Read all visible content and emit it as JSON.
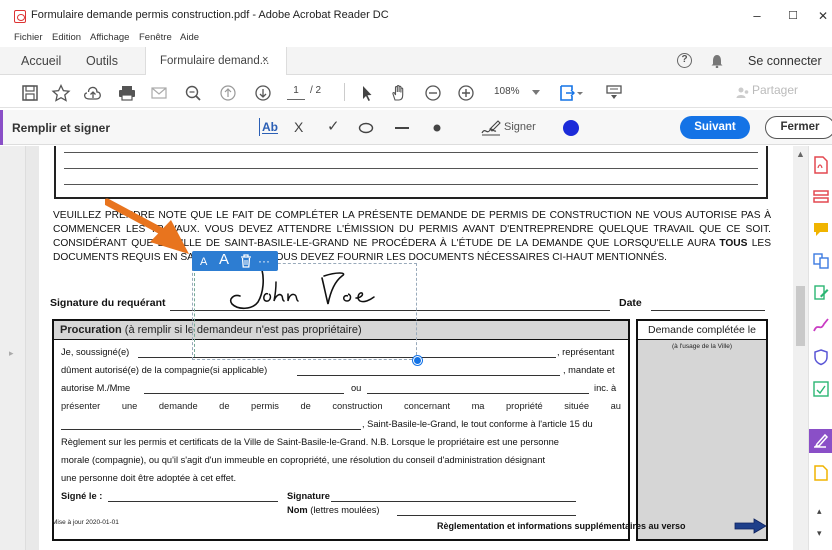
{
  "window": {
    "title": "Formulaire demande permis construction.pdf - Adobe Acrobat Reader DC",
    "minimize": "–",
    "maximize": "☐",
    "close": "✕"
  },
  "menu": [
    "Fichier",
    "Edition",
    "Affichage",
    "Fenêtre",
    "Aide"
  ],
  "tabs": {
    "home": "Accueil",
    "tools": "Outils",
    "doc": "Formulaire demand...",
    "doc_close": "×",
    "help_icon": "?",
    "signin": "Se connecter"
  },
  "toolbar": {
    "page_current": "1",
    "page_total": "/ 2",
    "zoom": "108%",
    "share": "Partager"
  },
  "fill_sign": {
    "title": "Remplir et signer",
    "text_tool": "Ab",
    "cross_tool": "X",
    "check_tool": "✓",
    "sign_label": "Signer",
    "next": "Suivant",
    "close": "Fermer",
    "ink_color": "#1c2bd9"
  },
  "annotation_toolbar": {
    "smaller": "A",
    "larger": "A",
    "more": "···"
  },
  "document": {
    "notice_parts": [
      "VEUILLEZ PRENDRE NOTE QUE LE FAIT DE COMPLÉTER LA PRÉSENTE DEMANDE DE PERMIS DE CONSTRUCTION NE VOUS AUTORISE PAS À COMMENCER LES TRAVAUX. VOUS DEVEZ ATTENDRE L'ÉMISSION DU PERMIS AVANT D'ENTREPRENDRE QUELQUE TRAVAIL QUE CE SOIT. CONSIDÉRANT QUE LA VILLE DE SAINT-BASILE-LE-GRAND NE PROCÉDERA À L'ÉTUDE DE LA DEMANDE QUE LORSQU'ELLE AURA ",
      "TOUS",
      " LES DOCUMENTS REQUIS EN SA POSSESSION, VOUS DEVEZ FOURNIR LES DOCUMENTS NÉCESSAIRES CI-HAUT MENTIONNÉS."
    ],
    "signature_label": "Signature du requérant",
    "date_label": "Date",
    "procuration": {
      "title_bold": "Procuration",
      "title_rest": " (à remplir si le demandeur n'est pas propriétaire)",
      "line1_prefix": "Je, soussigné(e)",
      "line1_suffix": ", représentant",
      "line2_prefix": "dûment autorisé(e) de la compagnie(si applicable)",
      "line2_suffix": ", mandate et",
      "line3_prefix": "autorise M./Mme",
      "line3_mid": "ou",
      "line3_suffix": "inc. à",
      "line4": [
        "présenter",
        "une",
        "demande",
        "de",
        "permis",
        "de",
        "construction",
        "concernant",
        "ma",
        "propriété",
        "située",
        "au"
      ],
      "line5": ", Saint-Basile-le-Grand, le tout conforme à l'article 15 du",
      "line6": "Règlement sur les permis et certificats de la Ville de Saint-Basile-le-Grand. N.B. Lorsque le propriétaire est une personne",
      "line7": "morale (compagnie), ou qu'il s'agit d'un immeuble en copropriété, une résolution du conseil d'administration désignant",
      "line8": "une personne doit être adoptée à cet effet.",
      "signed_label": "Signé le :",
      "signature_label": "Signature",
      "name_bold": "Nom",
      "name_rest": " (lettres moulées)"
    },
    "side": {
      "title": "Demande complétée le",
      "subtitle": "(à l'usage de la Ville)"
    },
    "update_note": "Mise à jour 2020-01-01",
    "footer_note": "Règlementation et informations supplémentaires au verso",
    "signature_ink": "John Doe"
  },
  "colors": {
    "accent_purple": "#8a4fc7",
    "primary_blue": "#1473e6",
    "annotation_blue": "#2d7dd2",
    "arrow_orange": "#e8741e",
    "pdf_red": "#d33"
  }
}
